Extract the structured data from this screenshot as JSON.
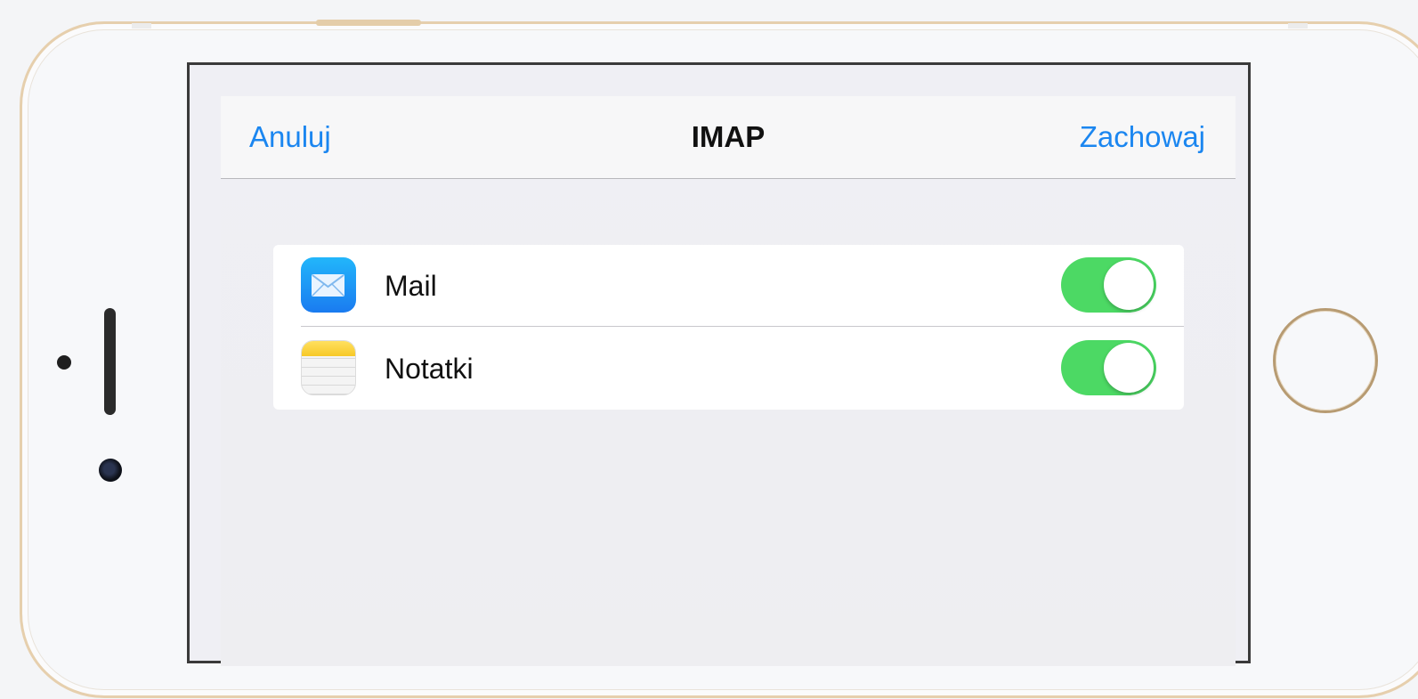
{
  "navbar": {
    "cancel_label": "Anuluj",
    "title": "IMAP",
    "save_label": "Zachowaj"
  },
  "items": [
    {
      "label": "Mail",
      "icon": "mail-app-icon",
      "enabled": true
    },
    {
      "label": "Notatki",
      "icon": "notes-app-icon",
      "enabled": true
    }
  ],
  "colors": {
    "accent": "#1b86f0",
    "toggle_on": "#4cd964",
    "background": "#efeff4"
  }
}
